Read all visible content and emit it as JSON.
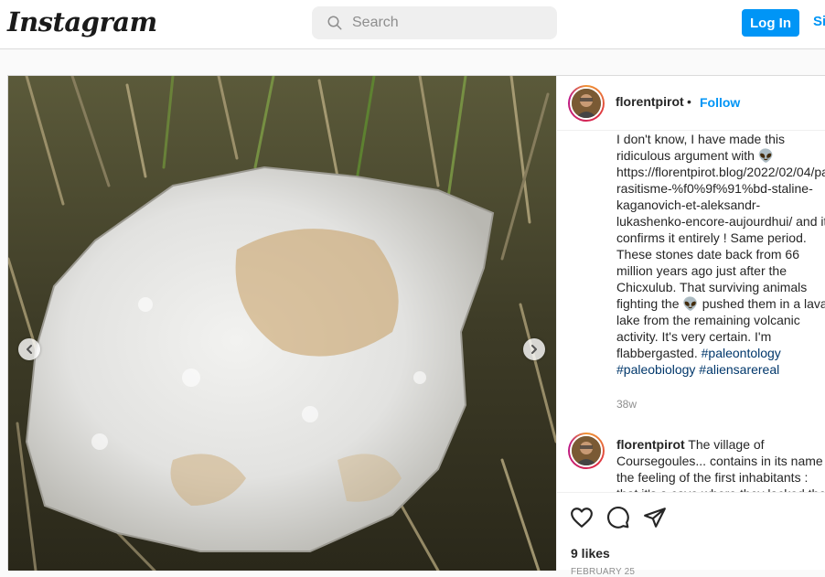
{
  "header": {
    "logo": "Instagram",
    "search_placeholder": "Search",
    "login_label": "Log In",
    "signup_label": "Si"
  },
  "post": {
    "username": "florentpirot",
    "follow_label": "Follow",
    "separator": "•",
    "caption": {
      "text": "I don't know, I have made this ridiculous argument with 👽 https://florentpirot.blog/2022/02/04/parasitisme-%f0%9f%91%bd-staline-kaganovich-et-aleksandr-lukashenko-encore-aujourdhui/ and it confirms it entirely ! Same period. These stones date back from 66 million years ago just after the Chicxulub. That surviving animals fighting the 👽 pushed them in a lava lake from the remaining volcanic activity. It's very certain. I'm flabbergasted.",
      "hashtags": [
        "#paleontology",
        "#paleobiology",
        "#aliensarereal"
      ],
      "time": "38w"
    },
    "second_comment": {
      "username": "florentpirot",
      "text": "The village of Coursegoules... contains in its name the feeling of the first inhabitants : that it's a cave where they lacked the current water"
    },
    "likes": "9 likes",
    "date": "FEBRUARY 25"
  },
  "icons": {
    "search": "search-icon",
    "like": "heart-icon",
    "comment": "comment-icon",
    "share": "paper-plane-icon",
    "prev": "chevron-left-icon",
    "next": "chevron-right-icon"
  },
  "colors": {
    "accent": "#0095f6",
    "hashtag": "#00376b",
    "muted": "#8e8e8e"
  }
}
